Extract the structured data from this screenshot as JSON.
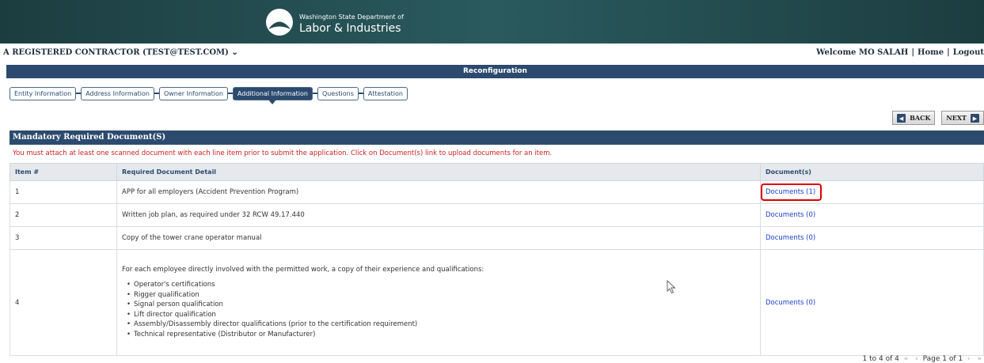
{
  "header": {
    "dept_line1": "Washington State Department of",
    "dept_line2": "Labor & Industries",
    "logo_icon": "washington-lni-logo-icon",
    "banner_color": "#244a4d"
  },
  "userbar": {
    "account_label": "A REGISTERED CONTRACTOR",
    "account_email": "(TEST@TEST.COM)",
    "account_caret": "⌄",
    "welcome": "Welcome MO SALAH",
    "home": "Home",
    "logout": "Logout"
  },
  "page": {
    "title": "Reconfiguration",
    "accent_color": "#2c4a6e",
    "alert_color": "#cc1f1f"
  },
  "steps": [
    {
      "label": "Entity Information"
    },
    {
      "label": "Address Information"
    },
    {
      "label": "Owner Information"
    },
    {
      "label": "Additional Information",
      "active": true
    },
    {
      "label": "Questions"
    },
    {
      "label": "Attestation"
    }
  ],
  "nav": {
    "back_label": "BACK",
    "next_label": "NEXT",
    "back_icon": "chevron-left-icon",
    "next_icon": "chevron-right-icon"
  },
  "section": {
    "title": "Mandatory Required Document(S)",
    "instruction": "You must attach at least one scanned document with each line item prior to submit the application. Click on Document(s) link to upload documents for an item."
  },
  "table": {
    "headers": {
      "item": "Item #",
      "detail": "Required Document Detail",
      "docs": "Document(s)"
    },
    "rows": [
      {
        "item": "1",
        "detail": "APP for all employers (Accident Prevention Program)",
        "docs": "Documents (1)"
      },
      {
        "item": "2",
        "detail": "Written job plan, as required under 32 RCW 49.17.440",
        "docs": "Documents (0)"
      },
      {
        "item": "3",
        "detail": "Copy of the tower crane operator manual",
        "docs": "Documents (0)"
      },
      {
        "item": "4",
        "detail": "For each employee directly involved with the permitted work, a copy of their experience and qualifications:",
        "bullets": [
          "Operator's certifications",
          "Rigger qualification",
          "Signal person qualification",
          "Lift director qualification",
          "Assembly/Disassembly director qualifications (prior to the certification requirement)",
          "Technical representative (Distributor or Manufacturer)"
        ],
        "docs": "Documents (0)"
      }
    ]
  },
  "pager": {
    "range": "1 to 4 of 4",
    "first": "«",
    "prev": "‹",
    "page_text": "Page 1 of 1",
    "next": "›",
    "last": "»"
  }
}
